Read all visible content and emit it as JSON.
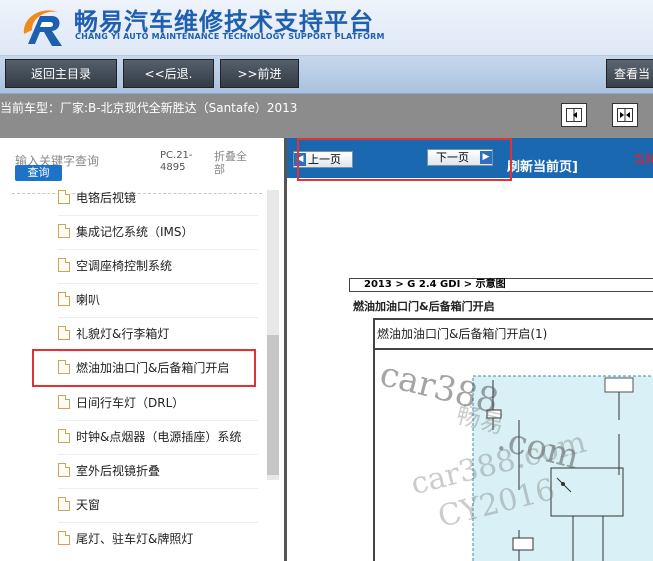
{
  "header": {
    "title": "畅易汽车维修技术支持平台",
    "subtitle": "CHANG YI AUTO MAINTENANCE TECHNOLOGY SUPPORT PLATFORM"
  },
  "nav": {
    "back_to_main": "返回主目录",
    "back": "<<后退.",
    "forward": ">>前进",
    "view_current": "查看当"
  },
  "info": {
    "vehicle": "当前车型：厂家:B-北京现代全新胜达（Santafe）2013"
  },
  "left": {
    "search_placeholder": "输入关键字查询",
    "search_button": "查询",
    "pc_code": "PC.21-4895",
    "fold_all": "折叠全部",
    "items": [
      {
        "label": "电铬后视镜"
      },
      {
        "label": "集成记忆系统（IMS）"
      },
      {
        "label": "空调座椅控制系统"
      },
      {
        "label": "喇叭"
      },
      {
        "label": "礼貌灯&行李箱灯"
      },
      {
        "label": "燃油加油口门&后备箱门开启"
      },
      {
        "label": "日间行车灯（DRL）"
      },
      {
        "label": "时钟&点烟器（电源插座）系统"
      },
      {
        "label": "室外后视镜折叠"
      },
      {
        "label": "天窗"
      },
      {
        "label": "尾灯、驻车灯&牌照灯"
      }
    ]
  },
  "right": {
    "prev_page": "上一页",
    "next_page": "下一页",
    "refresh": "刷新当前页]",
    "current": "当前",
    "breadcrumb": "2013 > G 2.4 GDI > 示意图",
    "doc_subtitle": "燃油加油口门&后备箱门开启",
    "frame_title": "燃油加油口门&后备箱门开启(1)",
    "watermarks": [
      "car388",
      "畅易",
      ".com",
      "car388.com",
      "CY2016"
    ]
  },
  "colors": {
    "brand_blue": "#1f5fb0",
    "toolbar_blue": "#1968b0",
    "highlight_red": "#e03333",
    "search_blue": "#1d73c7"
  }
}
